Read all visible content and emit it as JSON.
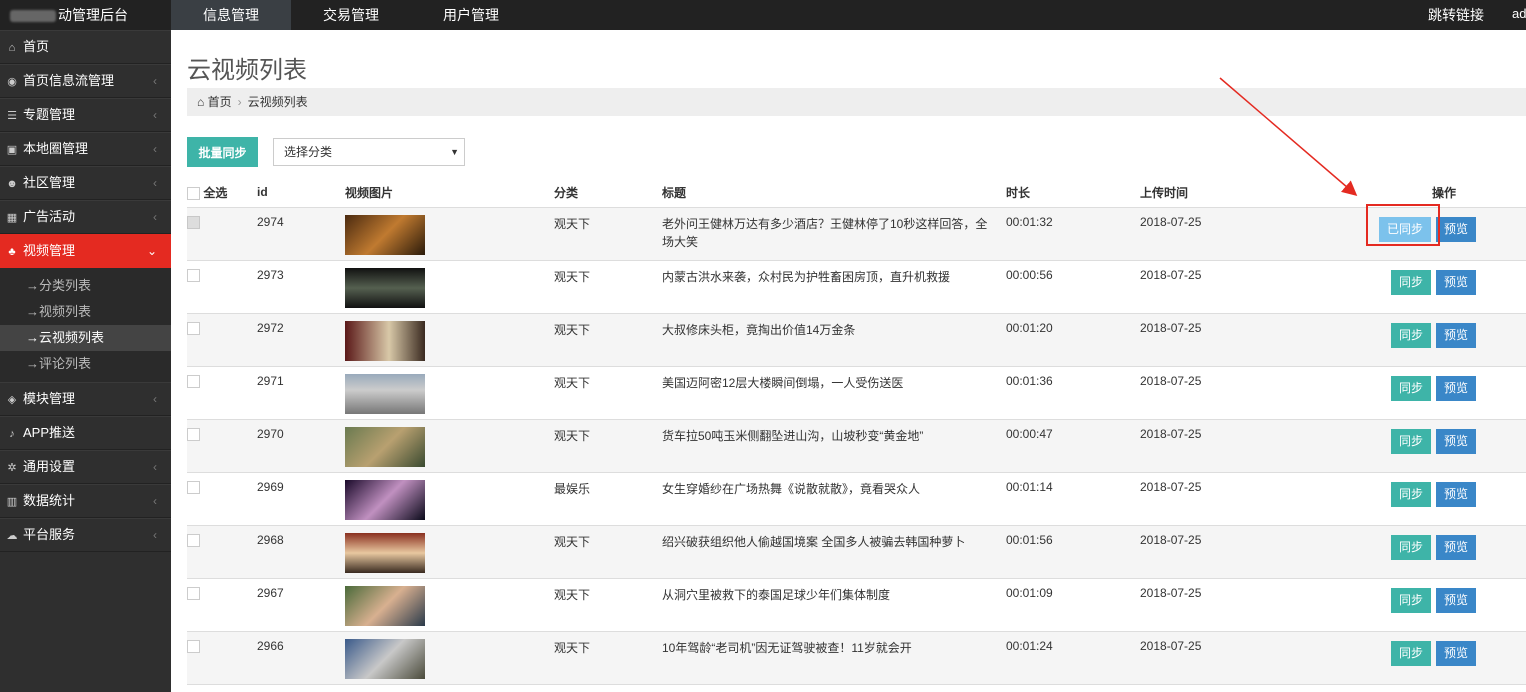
{
  "app": {
    "title": "动管理后台"
  },
  "topnav": {
    "items": [
      "信息管理",
      "交易管理",
      "用户管理"
    ],
    "link": "跳转链接",
    "user": "ad"
  },
  "sidebar": {
    "items": [
      {
        "label": "首页",
        "icon": "home-icon"
      },
      {
        "label": "首页信息流管理",
        "icon": "rss-icon"
      },
      {
        "label": "专题管理",
        "icon": "list-icon"
      },
      {
        "label": "本地圈管理",
        "icon": "image-icon"
      },
      {
        "label": "社区管理",
        "icon": "users-icon"
      },
      {
        "label": "广告活动",
        "icon": "calendar-icon"
      },
      {
        "label": "视频管理",
        "icon": "sitemap-icon"
      },
      {
        "label": "模块管理",
        "icon": "cubes-icon"
      },
      {
        "label": "APP推送",
        "icon": "bell-icon"
      },
      {
        "label": "通用设置",
        "icon": "cogs-icon"
      },
      {
        "label": "数据统计",
        "icon": "bar-chart-icon"
      },
      {
        "label": "平台服务",
        "icon": "cloud-icon"
      }
    ],
    "video_sub": [
      "分类列表",
      "视频列表",
      "云视频列表",
      "评论列表"
    ]
  },
  "page": {
    "title": "云视频列表",
    "breadcrumb": [
      "首页",
      "云视频列表"
    ],
    "batch_sync": "批量同步",
    "category_select": "选择分类"
  },
  "table": {
    "headers": {
      "select_all": "全选",
      "id": "id",
      "thumb": "视频图片",
      "category": "分类",
      "title": "标题",
      "duration": "时长",
      "upload": "上传时间",
      "ops": "操作"
    },
    "sync_label": "同步",
    "synced_label": "已同步",
    "preview_label": "预览",
    "rows": [
      {
        "id": "2974",
        "category": "观天下",
        "title": "老外问王健林万达有多少酒店？王健林停了10秒这样回答，全场大笑",
        "duration": "00:01:32",
        "date": "2018-07-25",
        "synced": true
      },
      {
        "id": "2973",
        "category": "观天下",
        "title": "内蒙古洪水来袭，众村民为护牲畜困房顶，直升机救援",
        "duration": "00:00:56",
        "date": "2018-07-25",
        "synced": false
      },
      {
        "id": "2972",
        "category": "观天下",
        "title": "大叔修床头柜，竟掏出价值14万金条",
        "duration": "00:01:20",
        "date": "2018-07-25",
        "synced": false
      },
      {
        "id": "2971",
        "category": "观天下",
        "title": "美国迈阿密12层大楼瞬间倒塌，一人受伤送医",
        "duration": "00:01:36",
        "date": "2018-07-25",
        "synced": false
      },
      {
        "id": "2970",
        "category": "观天下",
        "title": "货车拉50吨玉米侧翻坠进山沟，山坡秒变“黄金地”",
        "duration": "00:00:47",
        "date": "2018-07-25",
        "synced": false
      },
      {
        "id": "2969",
        "category": "最娱乐",
        "title": "女生穿婚纱在广场热舞《说散就散》，竟看哭众人",
        "duration": "00:01:14",
        "date": "2018-07-25",
        "synced": false
      },
      {
        "id": "2968",
        "category": "观天下",
        "title": "绍兴破获组织他人偷越国境案 全国多人被骗去韩国种萝卜",
        "duration": "00:01:56",
        "date": "2018-07-25",
        "synced": false
      },
      {
        "id": "2967",
        "category": "观天下",
        "title": "从洞穴里被救下的泰国足球少年们集体制度",
        "duration": "00:01:09",
        "date": "2018-07-25",
        "synced": false
      },
      {
        "id": "2966",
        "category": "观天下",
        "title": "10年驾龄“老司机”因无证驾驶被查！11岁就会开",
        "duration": "00:01:24",
        "date": "2018-07-25",
        "synced": false
      }
    ]
  },
  "colors": {
    "accent_red": "#e42a21",
    "teal": "#3eb4a8",
    "blue": "#3a87c8",
    "synced": "#7cc2ec"
  }
}
